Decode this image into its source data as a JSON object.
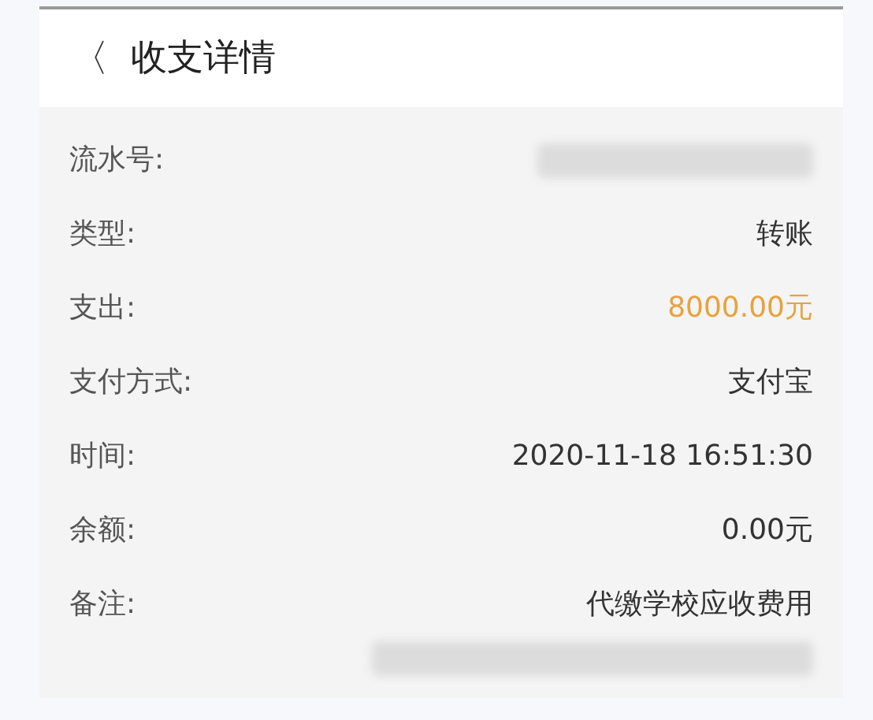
{
  "header": {
    "back": "〈",
    "title": "收支详情"
  },
  "rows": [
    {
      "label": "流水号:",
      "kind": "redacted"
    },
    {
      "label": "类型:",
      "kind": "text",
      "value": "转账"
    },
    {
      "label": "支出:",
      "kind": "amount",
      "value": "8000.00元"
    },
    {
      "label": "支付方式:",
      "kind": "text",
      "value": "支付宝"
    },
    {
      "label": "时间:",
      "kind": "text",
      "value": "2020-11-18 16:51:30"
    },
    {
      "label": "余额:",
      "kind": "text",
      "value": "0.00元"
    },
    {
      "label": "备注:",
      "kind": "text",
      "value": "代缴学校应收费用"
    }
  ],
  "note_redacted_line": true
}
